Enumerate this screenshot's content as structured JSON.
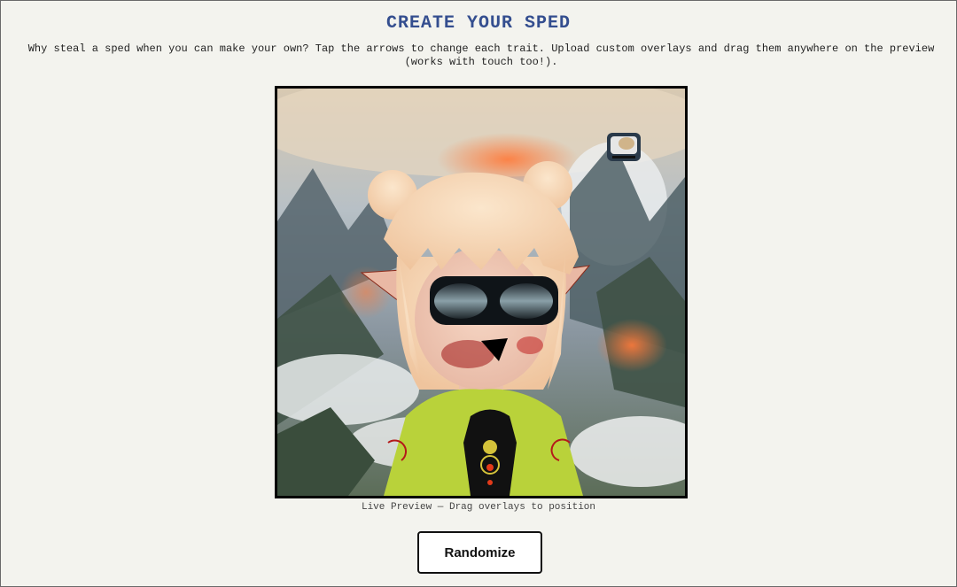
{
  "header": {
    "title": "CREATE YOUR SPED",
    "description": "Why steal a sped when you can make your own? Tap the arrows to change each trait. Upload custom overlays and drag them anywhere on the preview (works with touch too!)."
  },
  "preview": {
    "caption": "Live Preview — Drag overlays to position",
    "traits": {
      "background": "stormy-mountain-sky",
      "hair": "peach-space-buns",
      "ears": "elf-ears",
      "eyewear": "goggles",
      "mouth": "black-triangle-mouth",
      "top": "lime-shirt-target-print"
    },
    "overlays": [
      "toaster-sticker"
    ]
  },
  "actions": {
    "randomize_label": "Randomize"
  },
  "colors": {
    "title": "#344e8f",
    "background": "#f3f3ee",
    "shirt": "#b9d23a",
    "hair": "#f5d2b0"
  }
}
